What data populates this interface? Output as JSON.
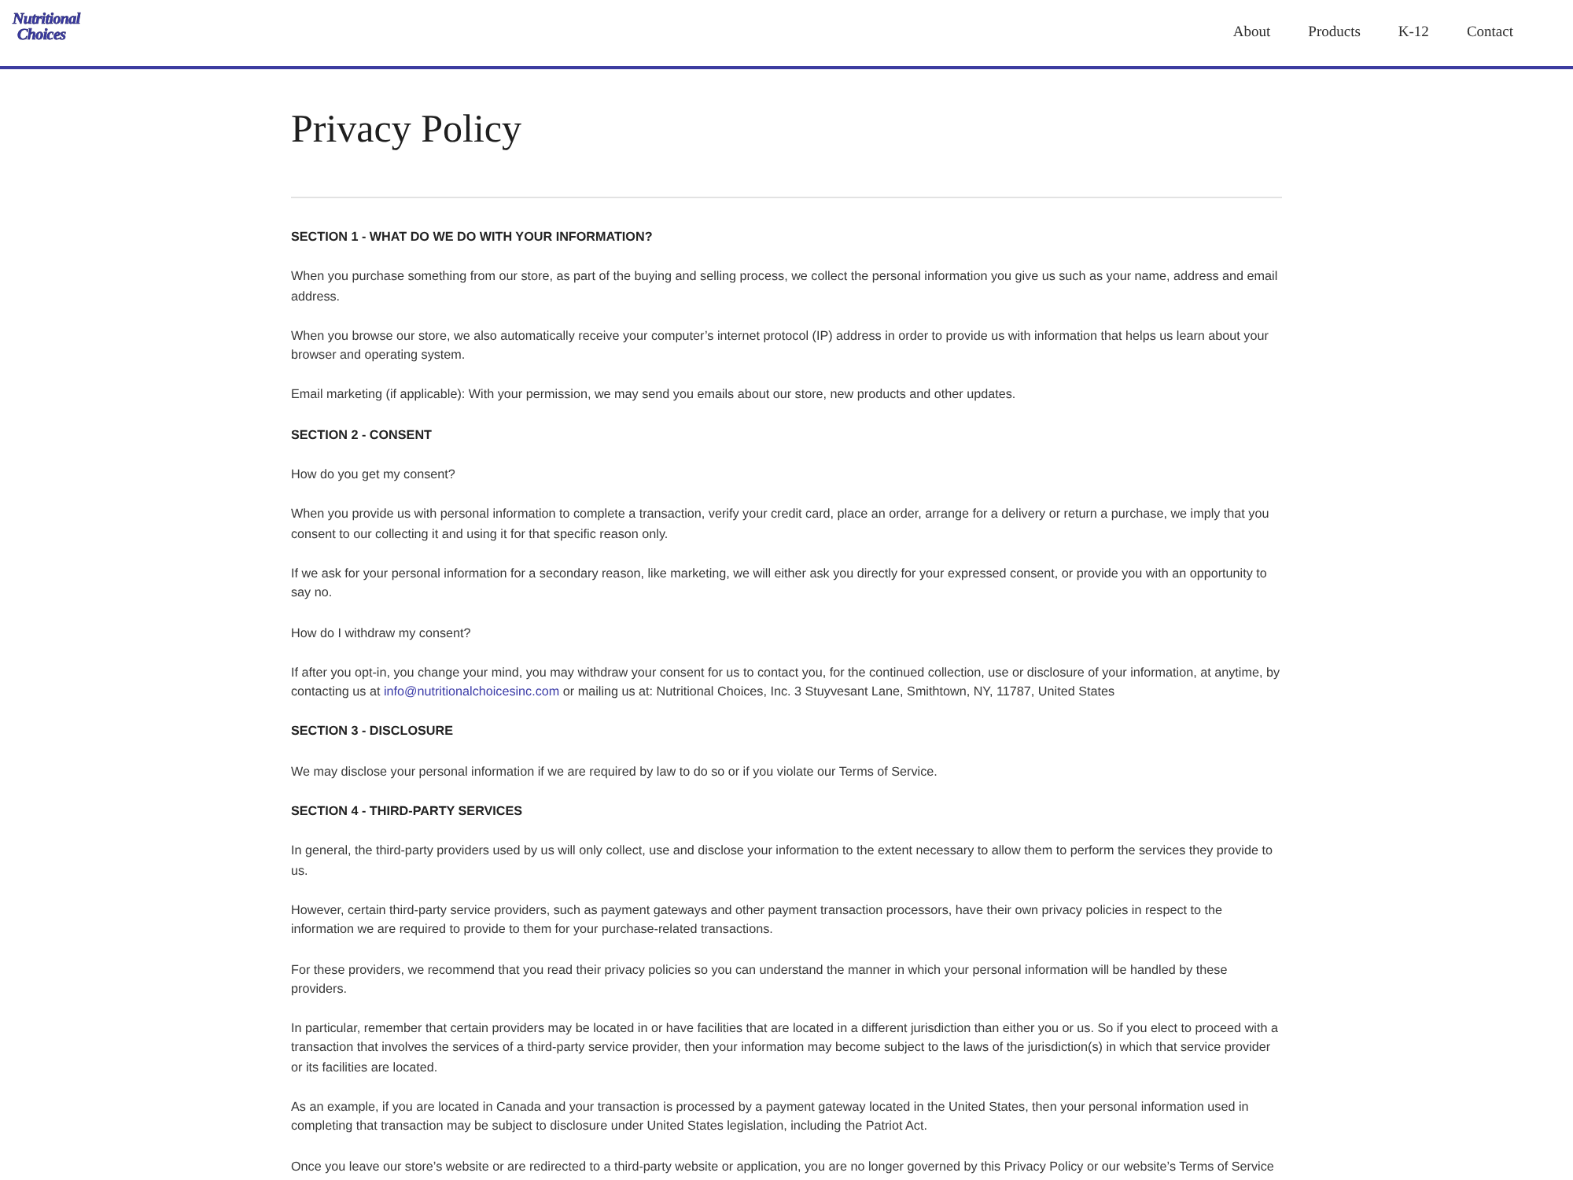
{
  "header": {
    "logo": {
      "lines": [
        "Nutritional",
        "Choices"
      ]
    },
    "nav": [
      "About",
      "Products",
      "K-12",
      "Contact"
    ]
  },
  "page": {
    "title": "Privacy Policy",
    "blocks": [
      {
        "kind": "heading",
        "text": "SECTION 1 - WHAT DO WE DO WITH YOUR INFORMATION?"
      },
      {
        "kind": "paragraph",
        "text": "When you purchase something from our store, as part of the buying and selling process, we collect the personal information you give us such as your name, address and email address."
      },
      {
        "kind": "paragraph",
        "text": "When you browse our store, we also automatically receive your computer’s internet protocol (IP) address in order to provide us with information that helps us learn about your browser and operating system."
      },
      {
        "kind": "paragraph",
        "text": "Email marketing (if applicable): With your permission, we may send you emails about our store, new products and other updates."
      },
      {
        "kind": "heading",
        "text": "SECTION 2 - CONSENT"
      },
      {
        "kind": "paragraph",
        "text": "How do you get my consent?"
      },
      {
        "kind": "paragraph",
        "text": "When you provide us with personal information to complete a transaction, verify your credit card, place an order, arrange for a delivery or return a purchase, we imply that you consent to our collecting it and using it for that specific reason only."
      },
      {
        "kind": "paragraph",
        "text": "If we ask for your personal information for a secondary reason, like marketing, we will either ask you directly for your expressed consent, or provide you with an opportunity to say no."
      },
      {
        "kind": "paragraph",
        "text": "How do I withdraw my consent?"
      },
      {
        "kind": "paragraph",
        "segments": [
          {
            "kind": "text",
            "text": "If after you opt-in, you change your mind, you may withdraw your consent for us to contact you, for the continued collection, use or disclosure of your information, at anytime, by contacting us at "
          },
          {
            "kind": "link",
            "text": "info@nutritionalchoicesinc.com"
          },
          {
            "kind": "text",
            "text": " or mailing us at: Nutritional Choices, Inc. 3 Stuyvesant Lane, Smithtown, NY, 11787, United States"
          }
        ]
      },
      {
        "kind": "heading",
        "text": "SECTION 3 - DISCLOSURE"
      },
      {
        "kind": "paragraph",
        "text": "We may disclose your personal information if we are required by law to do so or if you violate our Terms of Service."
      },
      {
        "kind": "heading",
        "text": "SECTION 4 - THIRD-PARTY SERVICES"
      },
      {
        "kind": "paragraph",
        "text": "In general, the third-party providers used by us will only collect, use and disclose your information to the extent necessary to allow them to perform the services they provide to us."
      },
      {
        "kind": "paragraph",
        "text": "However, certain third-party service providers, such as payment gateways and other payment transaction processors, have their own privacy policies in respect to the information we are required to provide to them for your purchase-related transactions."
      },
      {
        "kind": "paragraph",
        "text": "For these providers, we recommend that you read their privacy policies so you can understand the manner in which your personal information will be handled by these providers."
      },
      {
        "kind": "paragraph",
        "text": "In particular, remember that certain providers may be located in or have facilities that are located in a different jurisdiction than either you or us. So if you elect to proceed with a transaction that involves the services of a third-party service provider, then your information may become subject to the laws of the jurisdiction(s) in which that service provider or its facilities are located."
      },
      {
        "kind": "paragraph",
        "text": "As an example, if you are located in Canada and your transaction is processed by a payment gateway located in the United States, then your personal information used in completing that transaction may be subject to disclosure under United States legislation, including the Patriot Act."
      },
      {
        "kind": "paragraph",
        "text": "Once you leave our store’s website or are redirected to a third-party website or application, you are no longer governed by this Privacy Policy or our website’s Terms of Service"
      }
    ]
  }
}
